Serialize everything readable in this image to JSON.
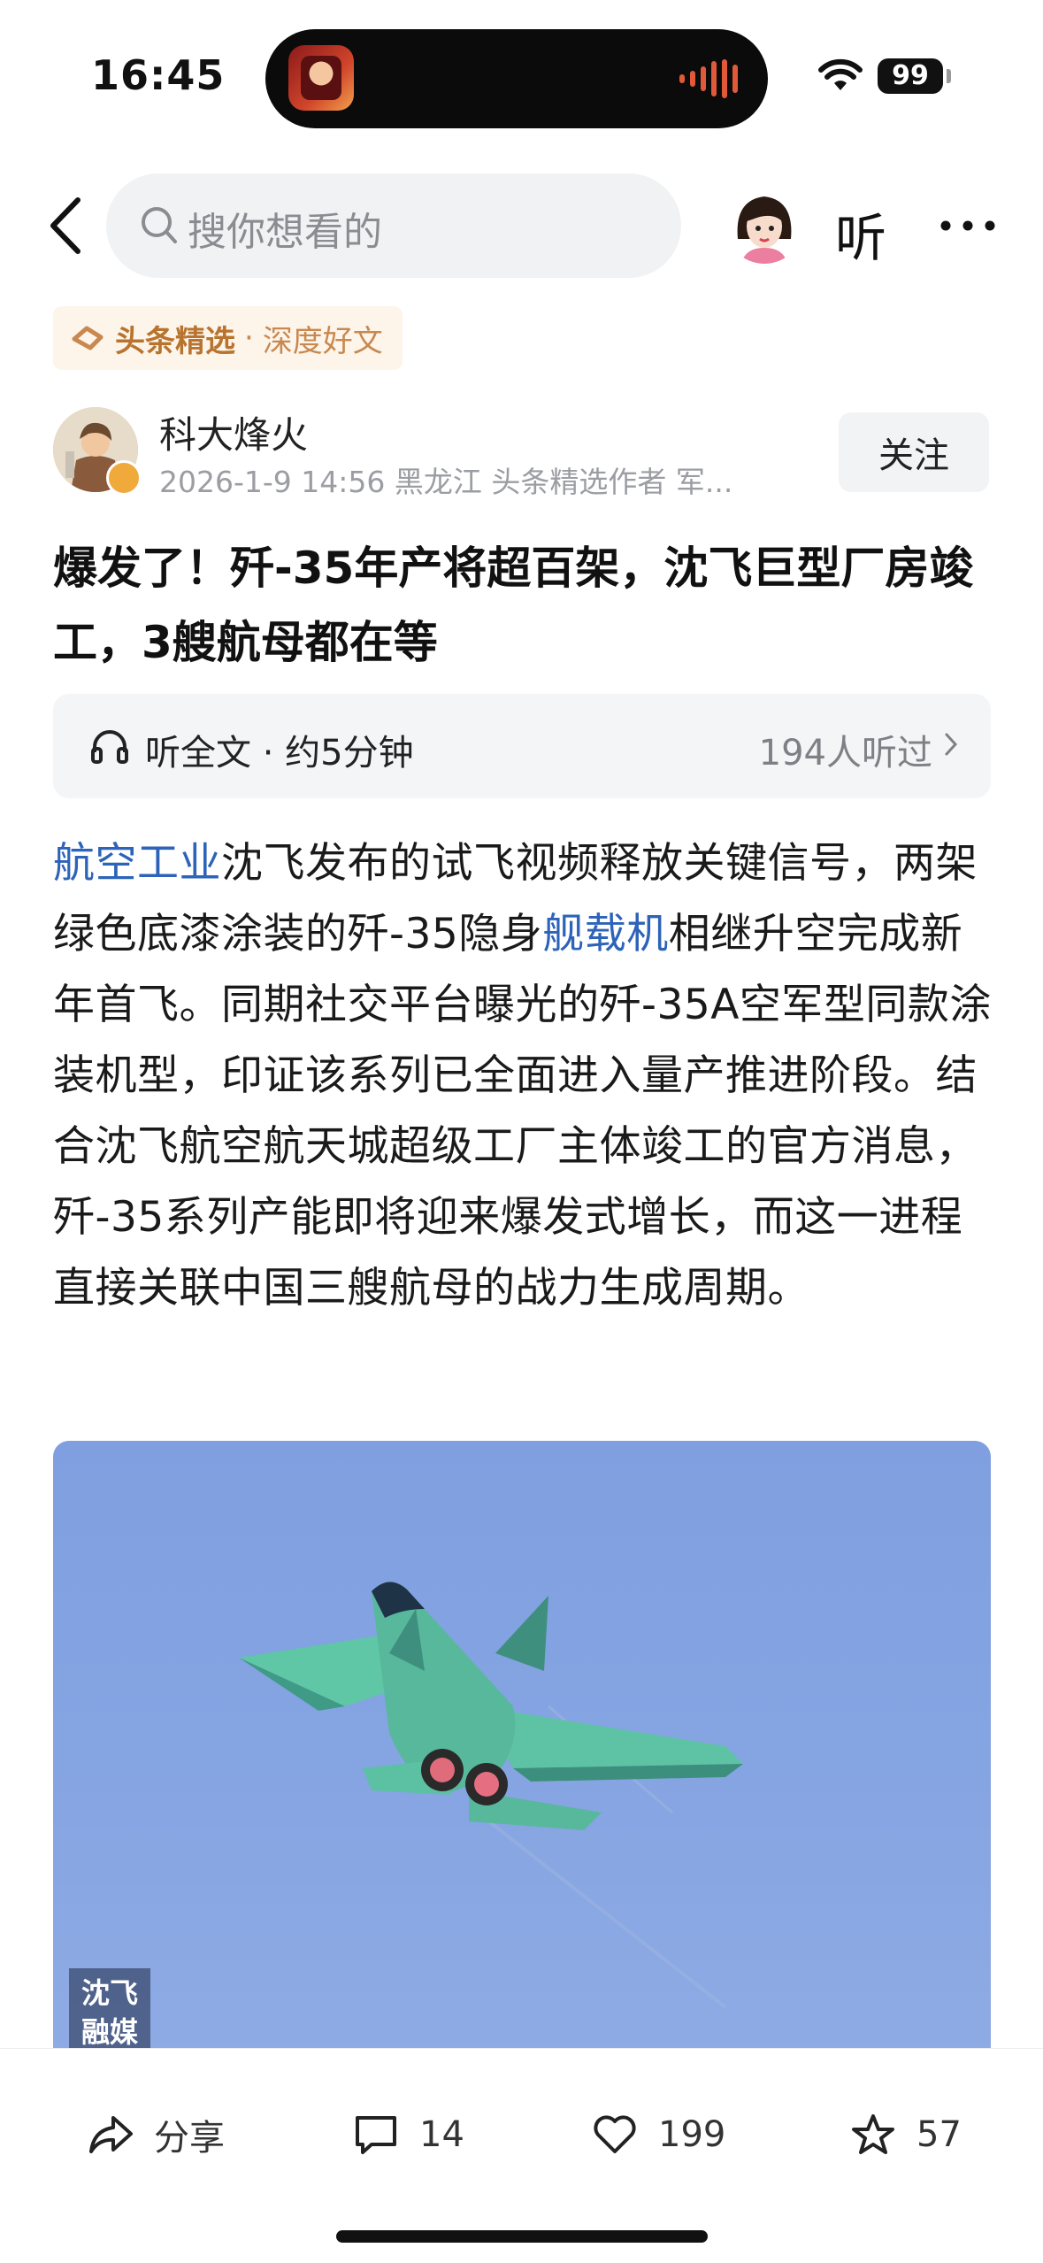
{
  "status_bar": {
    "time": "16:45",
    "battery": "99"
  },
  "nav": {
    "search_placeholder": "搜你想看的",
    "listen_label": "听"
  },
  "badge": {
    "brand": "头条精选",
    "separator": "·",
    "tag": "深度好文"
  },
  "author": {
    "name": "科大烽火",
    "meta": "2026-1-9  14:56  黑龙江  头条精选作者 军...",
    "follow_label": "关注"
  },
  "article": {
    "title": "爆发了！歼-35年产将超百架，沈飞巨型厂房竣工，3艘航母都在等",
    "listen_card": {
      "label": "听全文 · 约5分钟",
      "count": "194人听过"
    },
    "body": {
      "link1": "航空工业",
      "text1": "沈飞发布的试飞视频释放关键信号，两架绿色底漆涂装的歼-35隐身",
      "link2": "舰载机",
      "text2": "相继升空完成新年首飞。同期社交平台曝光的歼-35A空军型同款涂装机型，印证该系列已全面进入量产推进阶段。结合沈飞航空航天城超级工厂主体竣工的官方消息，歼-35系列产能即将迎来爆发式增长，而这一进程直接关联中国三艘航母的战力生成周期。"
    },
    "image": {
      "watermark_line1": "沈飞",
      "watermark_line2": "融媒"
    }
  },
  "bottom_bar": {
    "share_label": "分享",
    "comments": "14",
    "likes": "199",
    "favorites": "57"
  },
  "colors": {
    "link": "#2d63b8",
    "badge_text": "#c8884f",
    "badge_bg": "#fdf4ea",
    "sky": "#86a5e2"
  }
}
